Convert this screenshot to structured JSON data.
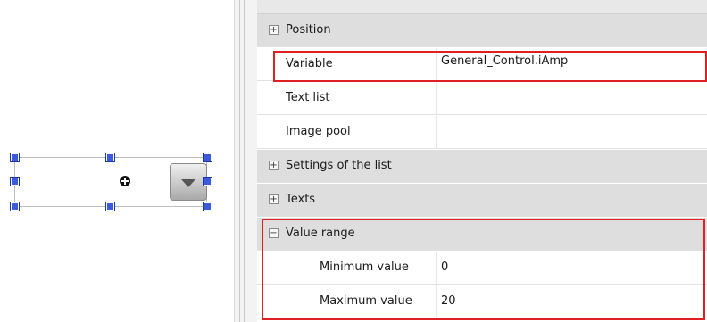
{
  "properties": {
    "rows": [
      {
        "label": "Position",
        "expander": "+",
        "kind": "category"
      },
      {
        "label": "Variable",
        "value": "General_Control.iAmp",
        "kind": "property"
      },
      {
        "label": "Text list",
        "value": "",
        "kind": "property"
      },
      {
        "label": "Image pool",
        "value": "",
        "kind": "property"
      },
      {
        "label": "Settings of the list",
        "expander": "+",
        "kind": "category"
      },
      {
        "label": "Texts",
        "expander": "+",
        "kind": "category"
      },
      {
        "label": "Value range",
        "expander": "−",
        "kind": "category"
      },
      {
        "label": "Minimum value",
        "value": "0",
        "kind": "sub-property"
      },
      {
        "label": "Maximum value",
        "value": "20",
        "kind": "sub-property"
      }
    ]
  },
  "canvas": {
    "control": "combo-box",
    "icons": {
      "center": "move-crosshair-icon",
      "dropdown": "dropdown-arrow-icon",
      "handles": "selection-handle-icon"
    }
  },
  "colors": {
    "highlight": "#e02020",
    "category_bg": "#dedede",
    "handle": "#3b5bdb"
  }
}
